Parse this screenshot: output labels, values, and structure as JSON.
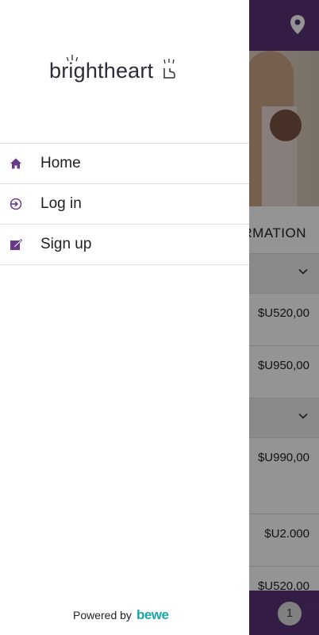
{
  "app": {
    "section_heading": "RMATION",
    "prices": [
      "$U520,00",
      "$U950,00",
      "$U990,00",
      "$U2.000",
      "$U520,00"
    ],
    "cart_count": "1",
    "carousel": {
      "active_index": 0,
      "count": 2
    }
  },
  "drawer": {
    "logo_text": "brightheart",
    "menu": [
      {
        "label": "Home",
        "icon": "home-icon"
      },
      {
        "label": "Log in",
        "icon": "login-icon"
      },
      {
        "label": "Sign up",
        "icon": "edit-icon"
      }
    ],
    "powered_by_label": "Powered by",
    "powered_by_brand": "bewe"
  },
  "colors": {
    "brand_purple": "#5a3278",
    "icon_purple": "#6a3a8a",
    "bewe_teal": "#1aa5a8"
  }
}
